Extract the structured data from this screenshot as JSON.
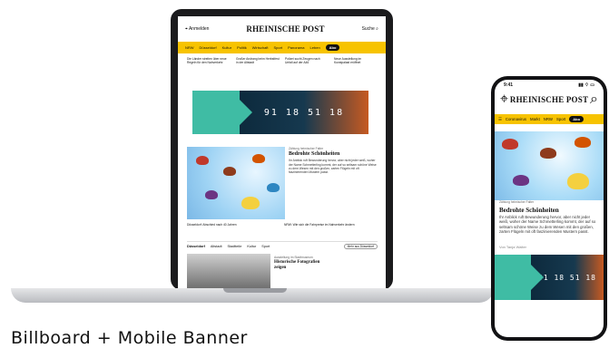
{
  "desktop": {
    "brand": "RHEINISCHE POST",
    "top_left": "Anmelden",
    "top_right": "Suche",
    "nav_items": [
      "NRW",
      "Düsseldorf",
      "Kultur",
      "Politik",
      "Wirtschaft",
      "Sport",
      "Panorama",
      "Leben",
      "Abo"
    ],
    "teasers": [
      "Die Länder streiten über neue Regeln für den Nahverkehr",
      "Großer Andrang beim Herbstfest in der Altstadt",
      "Polizei sucht Zeugen nach Unfall auf der A46",
      "Neue Ausstellung im Kunstpalast eröffnet"
    ],
    "countdown": "91 18 51 18",
    "article": {
      "kicker": "Zählung heimischer Falter",
      "headline": "Bedrohte Schönheiten",
      "body": "Ihr Anblick ruft Bewunderung hervor, aber nicht jeder weiß, woher der Name Schmetterling kommt, der auf so seltsam schöne Weise zu dem Wesen mit den großen, zarten Flügeln mit oft faszinierenden Mustern passt."
    },
    "captions": [
      "Düsseldorf: Abschied nach 40 Jahren",
      "NRW: Wie sich die Fahrpreise im Nahverkehr ändern"
    ],
    "section": {
      "title": "Düsseldorf",
      "tabs": [
        "Altstadt",
        "Stadtteile",
        "Kultur",
        "Sport"
      ],
      "more": "Mehr aus Düsseldorf"
    },
    "photo_caption": {
      "kicker": "Ausstellung im Stadtmuseum",
      "title": "Historische Fotografien zeigen"
    }
  },
  "mobile": {
    "time": "9:41",
    "brand": "RHEINISCHE POST",
    "nav_items": [
      "Coronavirus",
      "Markt",
      "NRW",
      "Sport",
      "Abo"
    ],
    "article": {
      "kicker": "Zählung heimischer Falter",
      "headline": "Bedrohte Schönheiten",
      "body": "Ihr Anblick ruft Bewunderung hervor, aber nicht jeder weiß, woher der Name Schmetterling kommt, der auf so seltsam schöne Weise zu dem Wesen mit den großen, zarten Flügeln mit oft faszinierenden Mustern passt."
    },
    "author": "Von Tanja Walter",
    "countdown": "91 18 51 18"
  },
  "label": "Billboard + Mobile Banner",
  "colors": {
    "accent_yellow": "#f7c300",
    "teal": "#3fbca4",
    "dark_blue": "#0d2a3d",
    "orange": "#c65a22"
  },
  "icons": [
    "location-icon",
    "search-icon",
    "menu-icon",
    "signal-icon",
    "wifi-icon",
    "battery-icon"
  ]
}
